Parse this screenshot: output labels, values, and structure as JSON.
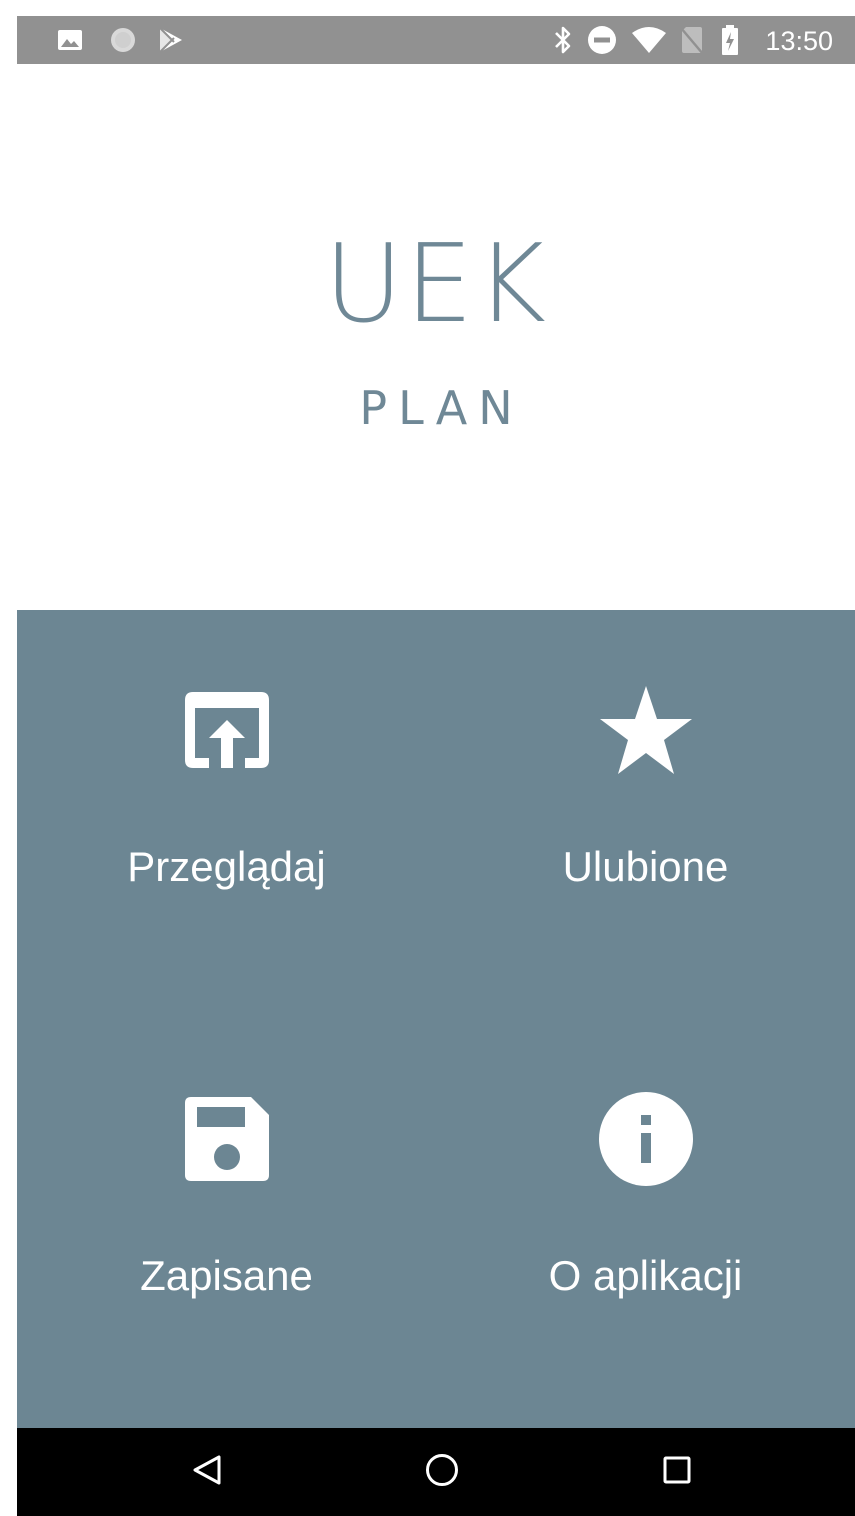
{
  "status_bar": {
    "time": "13:50",
    "left_icons": [
      "image-icon",
      "circle-icon",
      "play-store-icon"
    ],
    "right_icons": [
      "bluetooth-icon",
      "do-not-disturb-icon",
      "wifi-icon",
      "no-sim-icon",
      "battery-charging-icon"
    ]
  },
  "header": {
    "title": "UEK",
    "subtitle": "PLAN"
  },
  "menu": {
    "items": [
      {
        "label": "Przeglądaj",
        "icon": "open-in-browser-icon"
      },
      {
        "label": "Ulubione",
        "icon": "star-icon"
      },
      {
        "label": "Zapisane",
        "icon": "save-icon"
      },
      {
        "label": "O aplikacji",
        "icon": "info-icon"
      }
    ]
  },
  "nav_bar": {
    "buttons": [
      "back-icon",
      "home-icon",
      "recents-icon"
    ]
  },
  "colors": {
    "accent": "#6c8693",
    "logo_text": "#6f8896",
    "status_bar": "#919191",
    "nav_bar": "#000000"
  }
}
